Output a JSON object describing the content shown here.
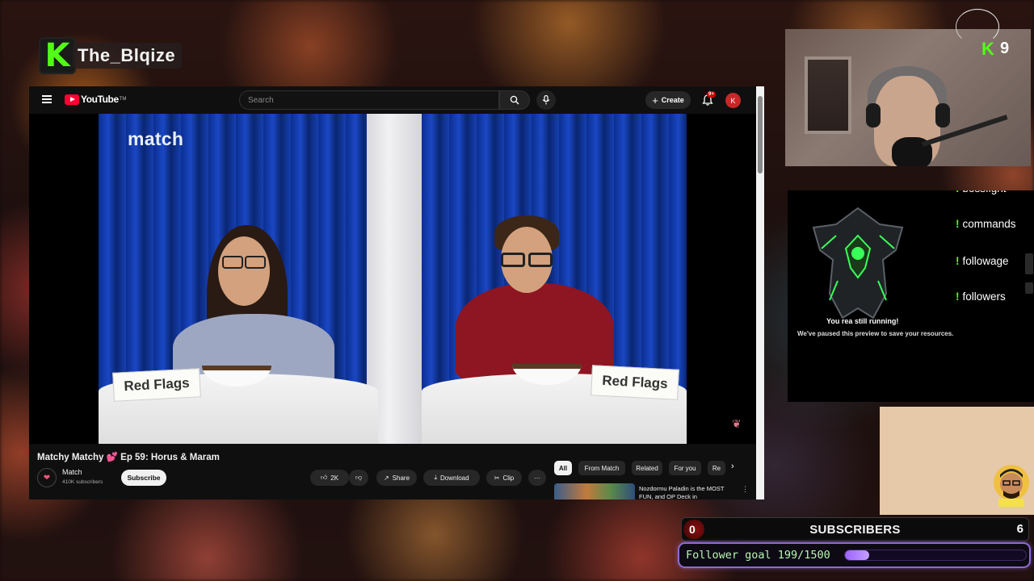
{
  "overlay": {
    "channel_name": "The_Blqize",
    "kick_logo_letter": "K",
    "viewer_count": "9",
    "accent_green": "#53fc18"
  },
  "youtube": {
    "logo_text": "YouTube",
    "logo_tm": "TM",
    "search_placeholder": "Search",
    "create_label": "Create",
    "notification_badge": "9+",
    "avatar_letter": "K",
    "video": {
      "watermark_logo": "match",
      "left_sign": "Red Flags",
      "right_sign": "Red Flags"
    },
    "title": "Matchy Matchy 💕 Ep 59: Horus & Maram",
    "channel": {
      "name": "Match",
      "subscribers": "410K subscribers",
      "subscribe_label": "Subscribe"
    },
    "actions": {
      "likes": "2K",
      "share": "Share",
      "download": "Download",
      "clip": "Clip",
      "more": "···"
    },
    "chips": [
      "All",
      "From Match",
      "Related",
      "For you",
      "Re"
    ],
    "recommended": {
      "title": "Nozdormu Paladin is the MOST FUN, and OP Deck in"
    }
  },
  "panel": {
    "commands": [
      {
        "label": "bossfight"
      },
      {
        "label": "commands"
      },
      {
        "label": "followage"
      },
      {
        "label": "followers"
      }
    ],
    "paused_line1": "You      rea    still running!",
    "paused_line2": "We've paused this preview to save your resources."
  },
  "goals": {
    "subscribers_label": "SUBSCRIBERS",
    "subscribers_current": "0",
    "subscribers_target": "6",
    "follower_text": "Follower goal 199/1500",
    "follower_progress": 0.1327
  }
}
